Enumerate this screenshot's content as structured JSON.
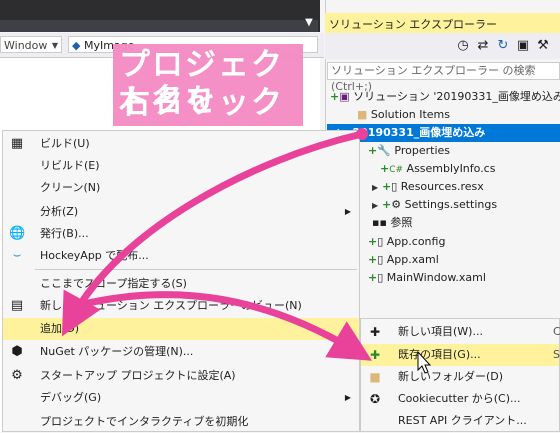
{
  "toolbar": {
    "window_combo": "Window",
    "target_combo": "MyImage"
  },
  "solution_explorer": {
    "title": "ソリューション エクスプローラー",
    "search_placeholder": "ソリューション エクスプローラー の検索 (Ctrl+;)",
    "tree": {
      "solution": "ソリューション '20190331_画像埋め込み' (1",
      "solution_items": "Solution Items",
      "project": "20190331_画像埋め込み",
      "properties": "Properties",
      "assemblyinfo": "AssemblyInfo.cs",
      "resources": "Resources.resx",
      "settings": "Settings.settings",
      "references": "参照",
      "app_config": "App.config",
      "app_xaml": "App.xaml",
      "mainwindow": "MainWindow.xaml"
    }
  },
  "banner": {
    "line1": "プロジェクト名を",
    "line2": "右クリック"
  },
  "context_menu": {
    "build": "ビルド(U)",
    "rebuild": "リビルド(E)",
    "clean": "クリーン(N)",
    "analyze": "分析(Z)",
    "publish": "発行(B)...",
    "hockeyapp": "HockeyApp で配布...",
    "scope": "ここまでスコープ指定する(S)",
    "new_view": "新しいソリューション エクスプローラーのビュー(N)",
    "add": "追加(D)",
    "nuget": "NuGet パッケージの管理(N)...",
    "startup": "スタートアップ プロジェクトに設定(A)",
    "debug": "デバッグ(G)",
    "interactive": "プロジェクトでインタラクティブを初期化"
  },
  "add_submenu": {
    "new_item": "新しい項目(W)...",
    "new_item_sc": "C",
    "existing_item": "既存の項目(G)...",
    "existing_item_sc": "S",
    "new_folder": "新しいフォルダー(D)",
    "cookiecutter": "Cookiecutter から(C)...",
    "rest_api": "REST API クライアント..."
  },
  "colors": {
    "highlight": "#fff29d",
    "selection": "#0078d7",
    "banner": "#f48cc4",
    "arrow": "#e8429a"
  }
}
